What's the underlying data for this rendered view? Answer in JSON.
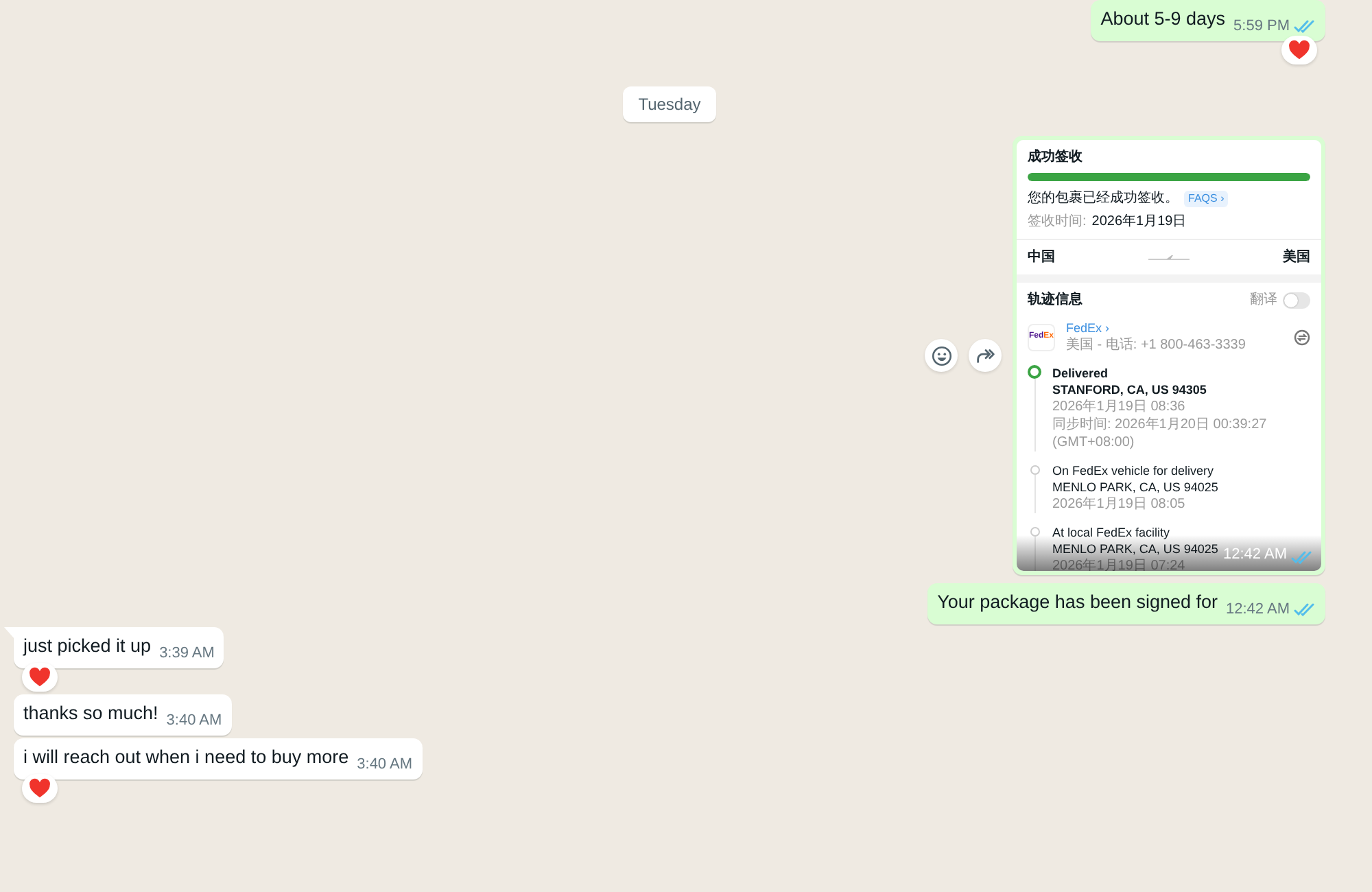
{
  "messages": [
    {
      "kind": "text",
      "outgoing": true,
      "text": "About 5-9 days",
      "time": "5:59 PM",
      "read": true,
      "reacted": true,
      "tail": false
    },
    {
      "kind": "date",
      "text": "Tuesday"
    },
    {
      "kind": "image",
      "outgoing": true,
      "time": "12:42 AM",
      "read": true,
      "reacted": false,
      "tail": false,
      "screenshot": {
        "status_title": "成功签收",
        "level": 1,
        "status_text": "您的包裹已经成功签收。",
        "faq_link": "FAQS ›",
        "sign_label": "签收时间:",
        "sign_date": "2026年1月19日",
        "origin": "中国",
        "destination": "美国",
        "section_title": "轨迹信息",
        "translate_label": "翻译",
        "translate_on": false,
        "carrier": {
          "logo": "FedEx",
          "name": "FedEx ›",
          "contact": "美国 - 电话: +1 800-463-3339"
        },
        "events": [
          {
            "title": "Delivered",
            "location": "STANFORD, CA, US 94305",
            "details": [
              "2026年1月19日 08:36",
              "同步时间: 2026年1月20日 00:39:27 (GMT+08:00)"
            ],
            "current": true
          },
          {
            "title": "On FedEx vehicle for delivery",
            "location": "MENLO PARK, CA, US 94025",
            "details": [
              "2026年1月19日 08:05"
            ],
            "current": false
          },
          {
            "title": "At local FedEx facility",
            "location": "MENLO PARK, CA, US 94025",
            "details": [
              "2026年1月19日 07:24"
            ],
            "current": false
          }
        ]
      }
    },
    {
      "kind": "text",
      "outgoing": true,
      "text": "Your package has been signed for",
      "time": "12:42 AM",
      "read": true,
      "reacted": false,
      "tail": false
    },
    {
      "kind": "text",
      "outgoing": false,
      "text": "just picked it up",
      "time": "3:39 AM",
      "reacted": true,
      "tail": true
    },
    {
      "kind": "text",
      "outgoing": false,
      "text": "thanks so much!",
      "time": "3:40 AM",
      "reacted": false,
      "tail": false
    },
    {
      "kind": "text",
      "outgoing": false,
      "text": "i will reach out when i need to buy more",
      "time": "3:40 AM",
      "reacted": true,
      "tail": false
    }
  ]
}
